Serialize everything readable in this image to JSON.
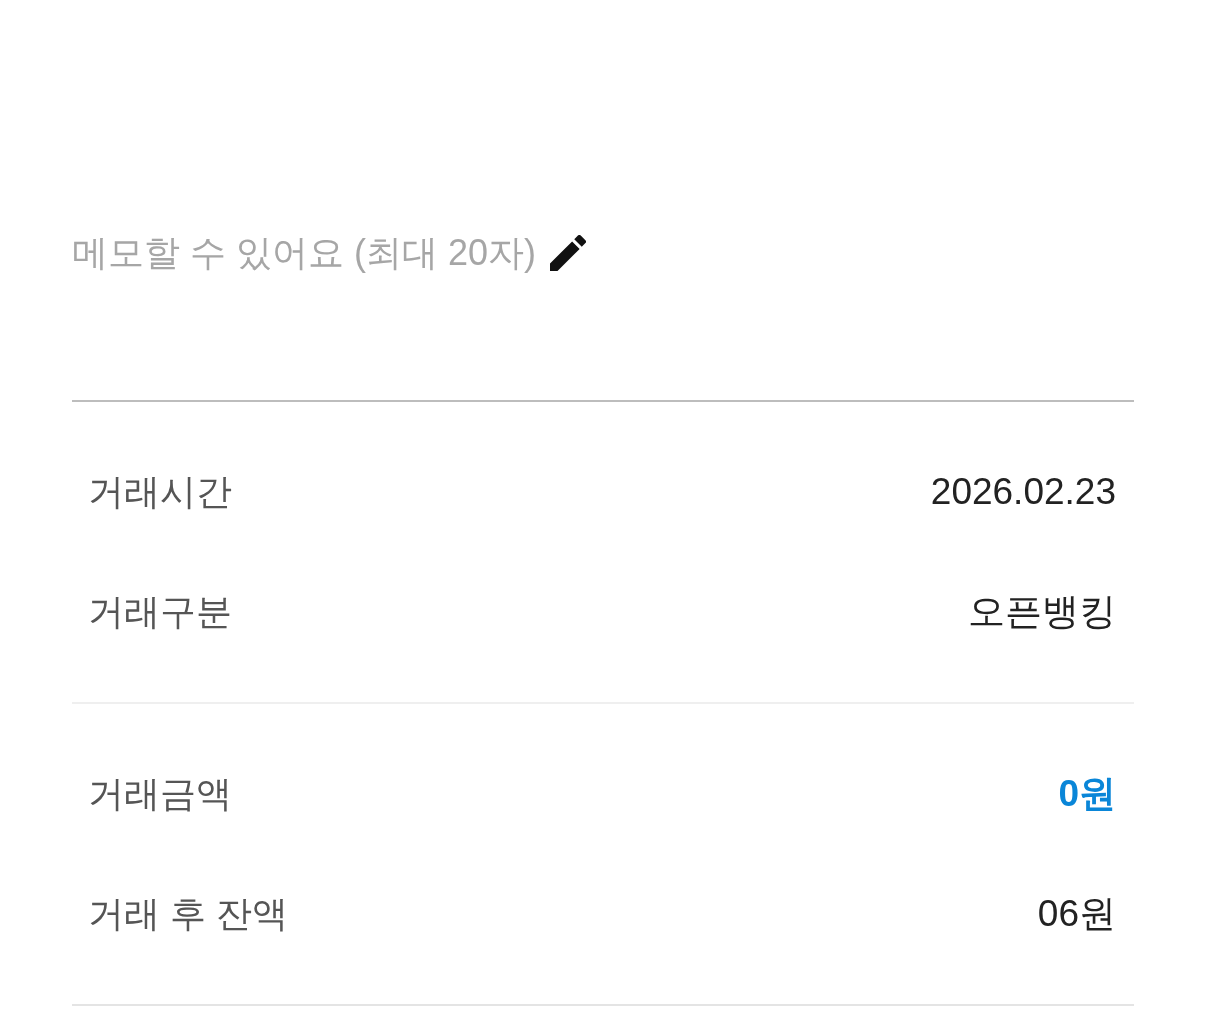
{
  "memo_prompt": {
    "text": "메모할 수 있어요 (최대 20자)"
  },
  "sections": [
    {
      "rows": [
        {
          "label": "거래시간",
          "value": "2026.02.23",
          "kind": "plain"
        },
        {
          "label": "거래구분",
          "value": "오픈뱅킹",
          "kind": "plain"
        }
      ]
    },
    {
      "rows": [
        {
          "label": "거래금액",
          "value": "0원",
          "kind": "amount"
        },
        {
          "label": "거래 후 잔액",
          "value": "06원",
          "kind": "plain"
        }
      ]
    }
  ]
}
